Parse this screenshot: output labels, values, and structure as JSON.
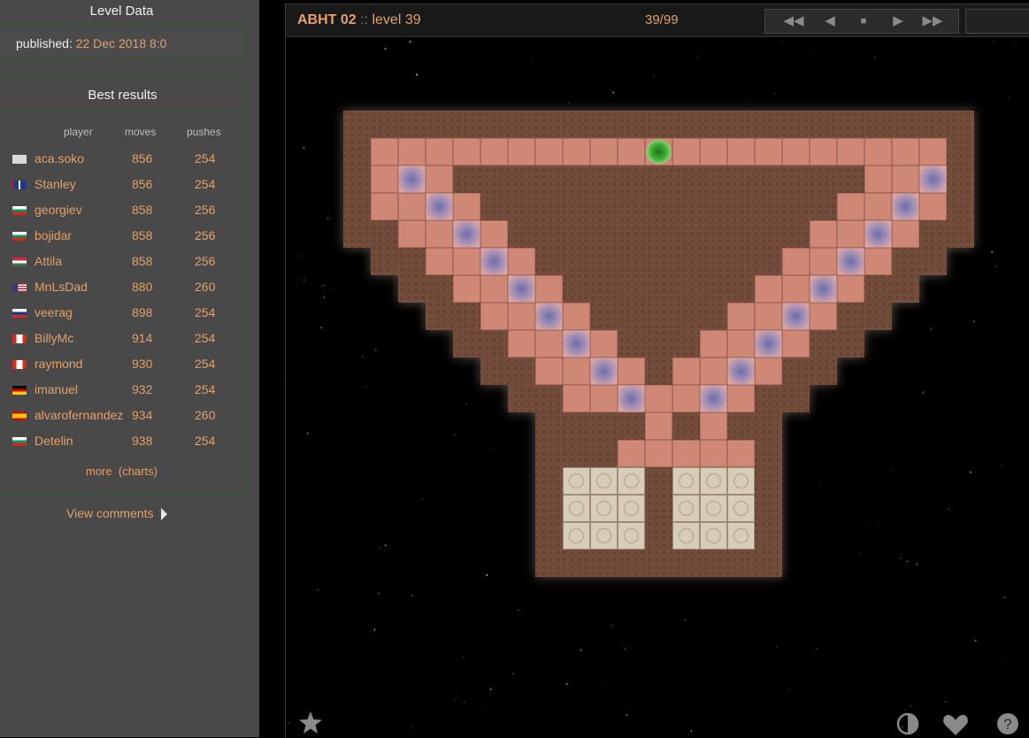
{
  "sidebar": {
    "level_data_title": "Level Data",
    "published_label": "published:",
    "published_value": "22 Dec 2018 8:0",
    "best_results_title": "Best results",
    "headers": {
      "player": "player",
      "moves": "moves",
      "pushes": "pushes"
    },
    "results": [
      {
        "flag": "blank",
        "player": "aca.soko",
        "moves": "856",
        "pushes": "254"
      },
      {
        "flag": "uk",
        "player": "Stanley",
        "moves": "856",
        "pushes": "254"
      },
      {
        "flag": "bulgaria",
        "player": "georgiev",
        "moves": "858",
        "pushes": "256"
      },
      {
        "flag": "bulgaria",
        "player": "bojidar",
        "moves": "858",
        "pushes": "256"
      },
      {
        "flag": "hungary",
        "player": "Attila",
        "moves": "858",
        "pushes": "256"
      },
      {
        "flag": "usa",
        "player": "MnLsDad",
        "moves": "880",
        "pushes": "260"
      },
      {
        "flag": "russia",
        "player": "veerag",
        "moves": "898",
        "pushes": "254"
      },
      {
        "flag": "canada",
        "player": "BillyMc",
        "moves": "914",
        "pushes": "254"
      },
      {
        "flag": "canada",
        "player": "raymond",
        "moves": "930",
        "pushes": "254"
      },
      {
        "flag": "germany",
        "player": "imanuel",
        "moves": "932",
        "pushes": "254"
      },
      {
        "flag": "spain",
        "player": "alvarofernandez",
        "moves": "934",
        "pushes": "260"
      },
      {
        "flag": "bulgaria",
        "player": "Detelin",
        "moves": "938",
        "pushes": "254"
      }
    ],
    "more_label": "more",
    "charts_label": "(charts)",
    "view_comments_label": "View comments"
  },
  "game": {
    "set_name": "ABHT 02",
    "separator": " :: ",
    "level_label": "level 39",
    "counter": "39/99",
    "nav_icons": [
      "first-icon",
      "previous-icon",
      "stop-icon",
      "next-icon",
      "last-icon"
    ],
    "nav_symbols": [
      "◀◀",
      "◀",
      "■",
      "▶",
      "▶▶"
    ],
    "bottom_icons": [
      "star-icon",
      "contrast-icon",
      "heart-icon",
      "help-icon"
    ],
    "help_symbol": "?"
  },
  "board": {
    "tiles_legend": {
      "#": "wall",
      " ": "floor",
      "$": "box",
      ".": "goal",
      "@": "player",
      "-": "outside"
    },
    "rows": [
      "###################",
      "#########@#########",
      "# $###########$ #",
      "#  $#########$  #",
      "#   $#######$   #",
      "#    $#####$    #",
      "#     $###$     #",
      "#      $#$      #",
      "#       $ $       #",
      "#      ## ##      #",
      "#      .. ..      #"
    ],
    "colors": {
      "wall": "#6f4a3a",
      "floor": "#d08876",
      "box": "#8f7aa6",
      "goal": "#d8cdb6",
      "player": "#3aa32e"
    }
  }
}
